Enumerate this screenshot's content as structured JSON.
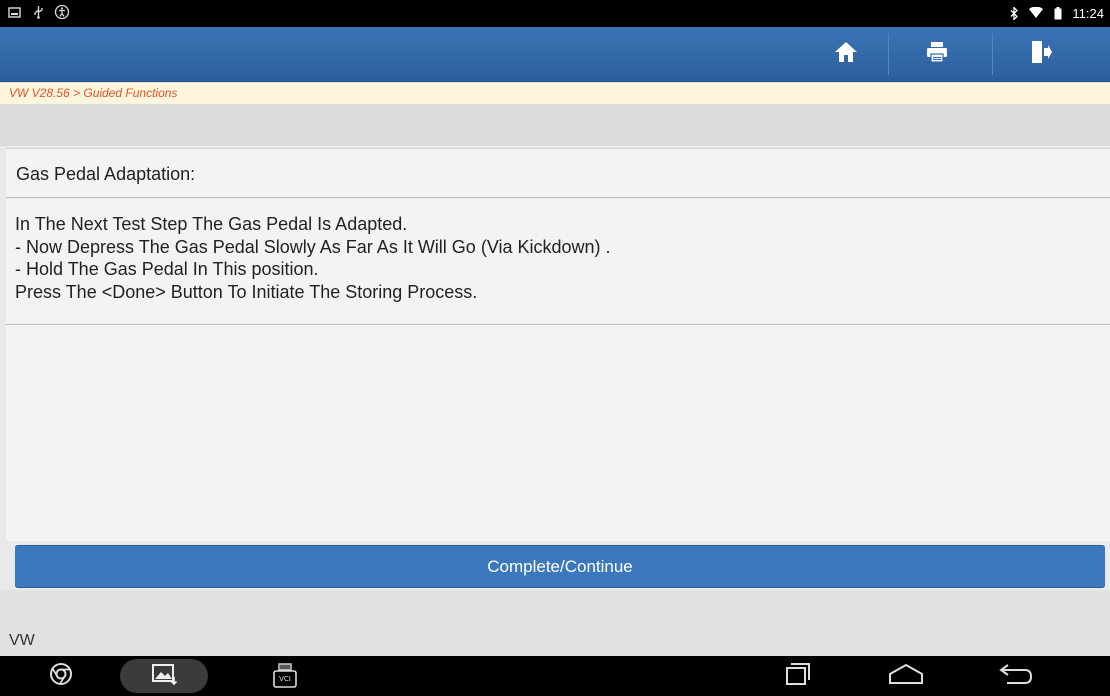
{
  "status_bar": {
    "left_icons": [
      "screenshot-icon",
      "usb-icon",
      "accessibility-icon"
    ],
    "right_icons": [
      "bluetooth-icon",
      "wifi-icon",
      "battery-icon"
    ],
    "time": "11:24"
  },
  "appbar": {
    "buttons": [
      "home-icon",
      "print-icon",
      "exit-icon"
    ]
  },
  "breadcrumb": "VW V28.56 > Guided Functions",
  "panel": {
    "title": "Gas Pedal Adaptation:",
    "lines": [
      "In The Next Test Step The Gas Pedal Is Adapted.",
      "- Now Depress The Gas Pedal Slowly As Far As It Will Go (Via Kickdown) .",
      "- Hold The Gas Pedal In This position.",
      "Press The <Done> Button To Initiate The Storing Process."
    ]
  },
  "continue_label": "Complete/Continue",
  "footer_brand": "VW",
  "navbar": {
    "left": [
      "chrome-icon",
      "gallery-icon",
      "vci-icon"
    ],
    "vci_text": "VCI",
    "right": [
      "recent-apps-icon",
      "home-nav-icon",
      "back-icon"
    ]
  },
  "colors": {
    "header_blue": "#2f67a8",
    "button_blue": "#3c78be",
    "breadcrumb_text": "#e0532c",
    "breadcrumb_bg": "#fdf6dc"
  }
}
